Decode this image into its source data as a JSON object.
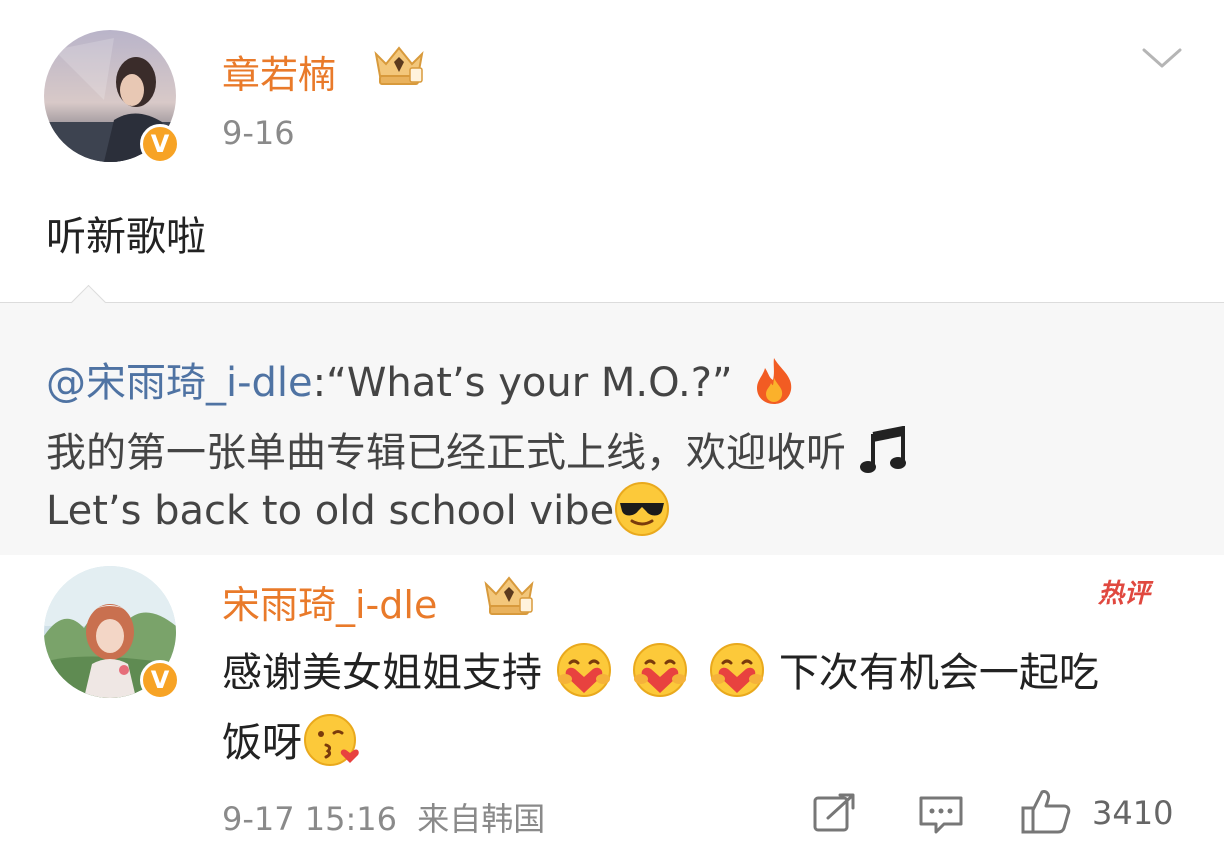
{
  "post": {
    "author": "章若楠",
    "date": "9-16",
    "text": "听新歌啦"
  },
  "repost": {
    "mention": "@宋雨琦_i-dle",
    "line1_rest": ":“What’s your M.O.?”",
    "line2": "我的第一张单曲专辑已经正式上线，欢迎收听",
    "line3": "Let’s back to old school vibe"
  },
  "comment": {
    "author": "宋雨琦_i-dle",
    "hot_badge": "热评",
    "text_part1": "感谢美女姐姐支持",
    "text_part2": "下次有机会一起吃",
    "text_line2": "饭呀",
    "timestamp": "9-17 15:16",
    "source": "来自韩国",
    "like_count": "3410"
  },
  "badges": {
    "verified": "V"
  },
  "icons": {
    "dropdown": "chevron-down-icon",
    "share": "share-icon",
    "comment": "comment-icon",
    "like": "like-icon",
    "crown": "crown-icon",
    "fire": "fire-emoji",
    "music": "music-notes-emoji",
    "sunglasses": "sunglasses-emoji",
    "hug": "hugging-emoji",
    "kiss": "kiss-emoji"
  },
  "colors": {
    "username": "#e97a2a",
    "mention": "#4f73a3",
    "verified": "#f7a325",
    "hot": "#e0483f",
    "meta": "#8a8a8a",
    "repost_bg": "#f7f7f7"
  }
}
